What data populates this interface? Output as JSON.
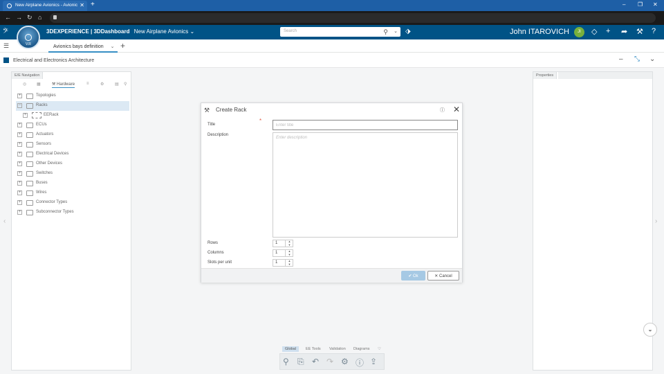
{
  "browser": {
    "tab_title": "New Airplane Avionics - Avionic",
    "new_tab": "+",
    "minimize": "–",
    "restore": "❐",
    "close": "✕"
  },
  "header": {
    "brand_bold": "3DEXPERIENCE | 3DDashboard",
    "context": "New Airplane Avionics",
    "search_placeholder": "Search",
    "user_name": "John ITAROVICH",
    "user_initials": "JI",
    "compass_version": "V.R"
  },
  "dashboard": {
    "active_tab": "Avionics bays definition",
    "add_tab": "+"
  },
  "app": {
    "title": "Electrical and Electronics Architecture"
  },
  "left_panel": {
    "tab": "E/E Navigation",
    "toolbar_label": "Hardware",
    "tree": [
      {
        "label": "Topologies",
        "expander": "+",
        "selected": false
      },
      {
        "label": "Racks",
        "expander": "−",
        "selected": true
      },
      {
        "label": "EERack",
        "expander": "+",
        "child": true
      },
      {
        "label": "ECUs",
        "expander": "+"
      },
      {
        "label": "Actuators",
        "expander": "+"
      },
      {
        "label": "Sensors",
        "expander": "+"
      },
      {
        "label": "Electrical Devices",
        "expander": "+"
      },
      {
        "label": "Other Devices",
        "expander": "+"
      },
      {
        "label": "Switches",
        "expander": "+"
      },
      {
        "label": "Buses",
        "expander": "+"
      },
      {
        "label": "Wires",
        "expander": "+"
      },
      {
        "label": "Connector Types",
        "expander": "+"
      },
      {
        "label": "Subconnector Types",
        "expander": "+"
      }
    ]
  },
  "right_panel": {
    "tab": "Properties"
  },
  "dialog": {
    "title": "Create Rack",
    "title_label": "Title",
    "required_mark": "*",
    "title_placeholder": "Enter title",
    "description_label": "Description",
    "description_placeholder": "Enter description",
    "rows_label": "Rows",
    "rows_value": "1",
    "columns_label": "Columns",
    "columns_value": "1",
    "slots_label": "Slots per unit",
    "slots_value": "1",
    "ok_label": "Ok",
    "cancel_label": "Cancel"
  },
  "action_bar": {
    "tabs": [
      "Global",
      "EE Tools",
      "Validation",
      "Diagrams"
    ],
    "active_tab": "Global"
  },
  "colors": {
    "header_bg": "#005386",
    "browser_bg": "#1e5fa6",
    "accent": "#368ec4",
    "avatar": "#78b03c"
  }
}
